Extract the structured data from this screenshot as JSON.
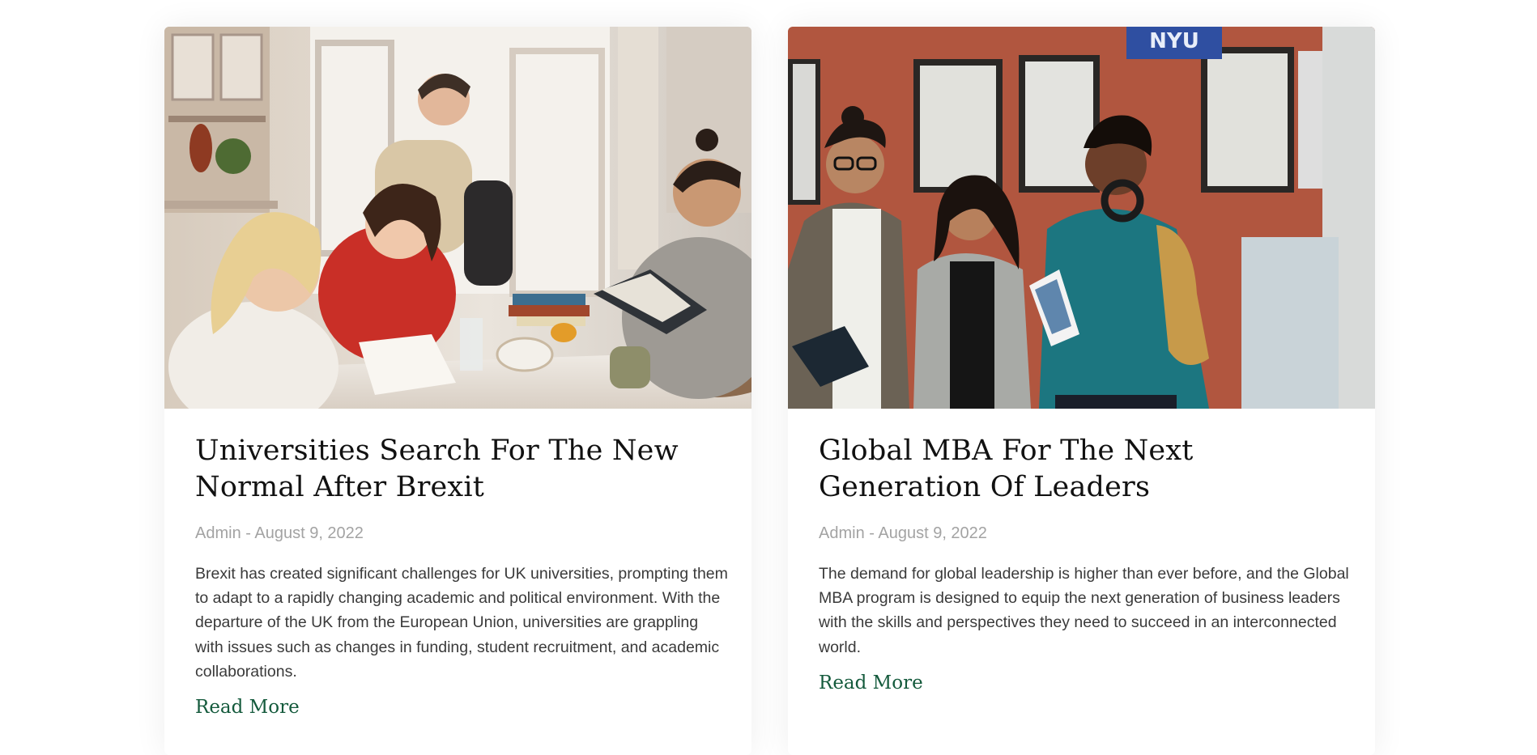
{
  "posts": [
    {
      "title": "Universities Search For The New Normal After Brexit",
      "author": "Admin",
      "separator": " - ",
      "date": "August 9, 2022",
      "excerpt": "Brexit has created significant challenges for UK universities, prompting them to adapt to a rapidly changing academic and political environment. With the departure of the UK from the European Union, universities are grappling with issues such as changes in funding, student recruitment, and academic collaborations.",
      "read_more": "Read More"
    },
    {
      "title": "Global MBA For The Next Generation Of Leaders",
      "author": "Admin",
      "separator": " - ",
      "date": "August 9, 2022",
      "excerpt": "The demand for global leadership is higher than ever before, and the Global MBA program is designed to equip the next generation of business leaders with the skills and perspectives they need to succeed in an interconnected world.",
      "read_more": "Read More",
      "banner_text": "NYU"
    }
  ],
  "colors": {
    "link": "#145a3c",
    "meta": "#a3a3a3",
    "title": "#111111",
    "body_text": "#3a3a3a"
  }
}
